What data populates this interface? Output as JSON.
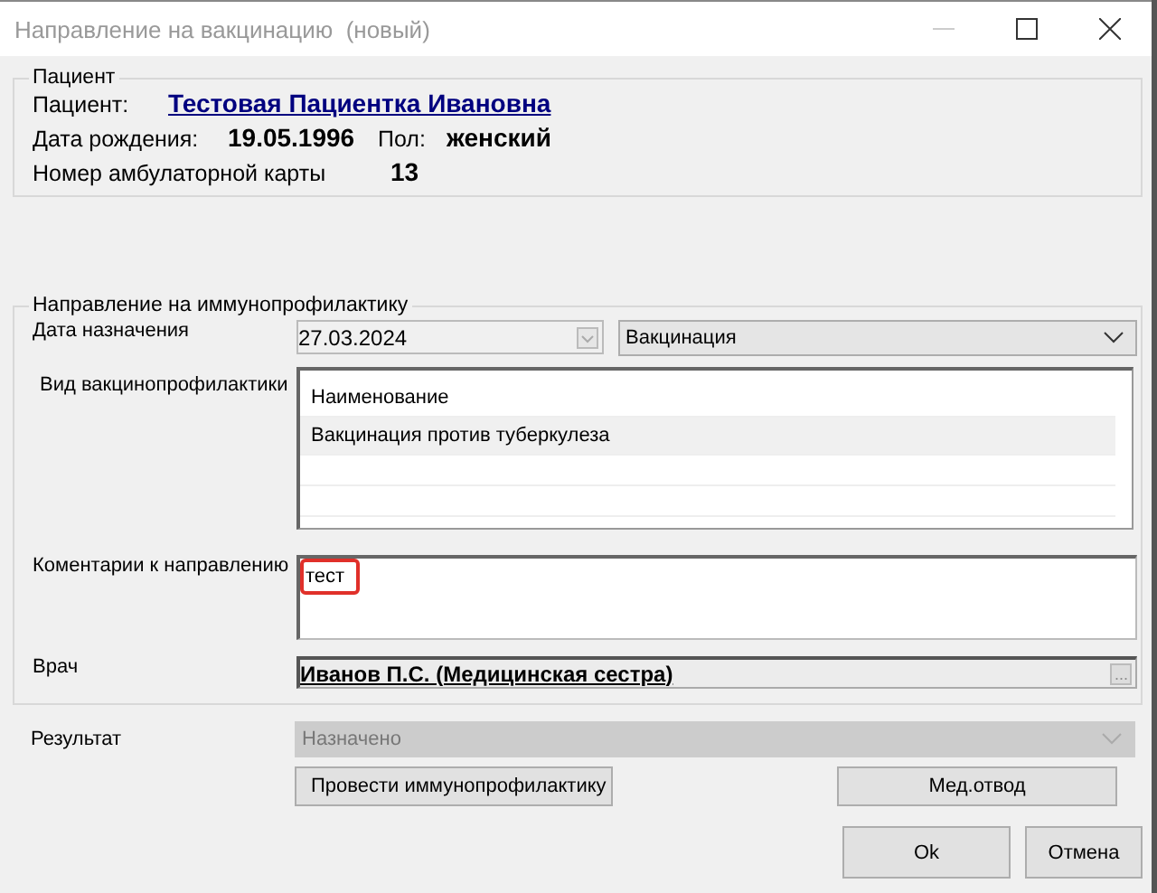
{
  "window": {
    "title": "Направление на вакцинацию  (новый)"
  },
  "patient_group": {
    "title": "Пациент",
    "patient_label": "Пациент:",
    "patient_name": "Тестовая Пациентка Ивановна",
    "birth_label": "Дата рождения:",
    "birth_date": "19.05.1996",
    "sex_label": "Пол:",
    "sex": "женский",
    "card_label": "Номер амбулаторной карты",
    "card_number": "13"
  },
  "referral_group": {
    "title": "Направление на иммунопрофилактику",
    "date_label": "Дата назначения",
    "date": "27.03.2024",
    "type_value": "Вакцинация",
    "kind_label": "Вид вакцинопрофилактики",
    "table": {
      "columns": [
        "Наименование"
      ],
      "rows": [
        {
          "name": "Вакцинация против туберкулеза",
          "selected": true
        }
      ]
    },
    "comment_label": "Коментарии к направлению",
    "comment": "тест",
    "comment_highlighted": true,
    "doctor_label": "Врач",
    "doctor": "Иванов П.С. (Медицинская сестра)",
    "doctor_button": "..."
  },
  "result": {
    "label": "Результат",
    "value": "Назначено",
    "disabled": true
  },
  "buttons": [
    {
      "label": "Провести иммунопрофилактику"
    },
    {
      "label": "Мед.отвод"
    }
  ],
  "footer_buttons": [
    {
      "label": "Ok"
    },
    {
      "label": "Отмена"
    }
  ]
}
